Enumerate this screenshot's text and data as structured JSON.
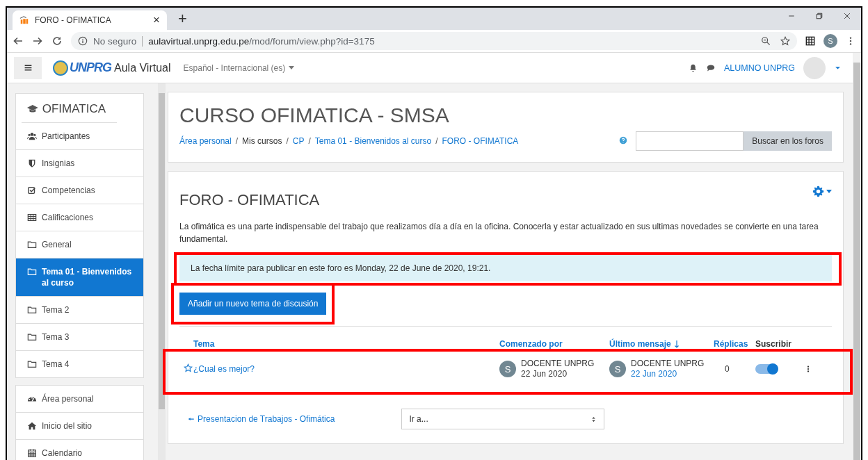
{
  "browser": {
    "tab_title": "FORO - OFIMATICA",
    "tab_close": "×",
    "new_tab": "+",
    "security": "No seguro",
    "url_host": "aulavirtual.unprg.edu.pe",
    "url_path": "/mod/forum/view.php?id=3175",
    "profile_initial": "S"
  },
  "navbar": {
    "logo": "UNPRG",
    "site_name": "Aula Virtual",
    "language": "Español - Internacional (es)",
    "user_name": "ALUMNO UNPRG"
  },
  "sidebar": {
    "course_title": "OFIMATICA",
    "items": [
      {
        "label": "Participantes",
        "kind": "users",
        "selected": false
      },
      {
        "label": "Insignias",
        "kind": "shield",
        "selected": false
      },
      {
        "label": "Competencias",
        "kind": "check",
        "selected": false
      },
      {
        "label": "Calificaciones",
        "kind": "table",
        "selected": false
      },
      {
        "label": "General",
        "kind": "folder",
        "selected": false
      },
      {
        "label": "Tema 01 - Bienvenidos al curso",
        "kind": "folder",
        "selected": true
      },
      {
        "label": "Tema 2",
        "kind": "folder",
        "selected": false
      },
      {
        "label": "Tema 3",
        "kind": "folder",
        "selected": false
      },
      {
        "label": "Tema 4",
        "kind": "folder",
        "selected": false
      }
    ],
    "site_items": [
      {
        "label": "Área personal",
        "kind": "gauge",
        "selected": false
      },
      {
        "label": "Inicio del sitio",
        "kind": "home",
        "selected": false
      },
      {
        "label": "Calendario",
        "kind": "calendar",
        "selected": false
      }
    ]
  },
  "header": {
    "course_name": "CURSO OFIMATICA - SMSA",
    "separators": [
      "/",
      "/",
      "/",
      "/"
    ],
    "breadcrumb": [
      {
        "label": "Área personal",
        "link": true
      },
      {
        "label": "Mis cursos",
        "link": false
      },
      {
        "label": "CP",
        "link": true
      },
      {
        "label": "Tema 01 - Bienvenidos al curso",
        "link": true
      },
      {
        "label": "FORO - OFIMATICA",
        "link": true
      }
    ],
    "search_button": "Buscar en los foros"
  },
  "forum": {
    "title": "FORO - OFIMATICA",
    "description": "La ofimática es una parte indispensable del trabajo que realizamos día a día en la oficina. Conocerla y estar actualizado en sus ultimas novedades se convierte en una tarea fundamental.",
    "notice": {
      "text": "La fecha límite para publicar en este foro es Monday, 22 de June de 2020, 19:21.",
      "highlighted": true
    },
    "add_button": {
      "label": "Añadir un nuevo tema de discusión",
      "highlighted": true
    },
    "columns": [
      {
        "label": "Tema",
        "link": true,
        "sorted": false
      },
      {
        "label": "Comenzado por",
        "link": true,
        "sorted": false
      },
      {
        "label": "Último mensaje",
        "link": true,
        "sorted": true
      },
      {
        "label": "Réplicas",
        "link": true,
        "sorted": false
      },
      {
        "label": "Suscribir",
        "link": false,
        "sorted": false
      }
    ],
    "discussions": [
      {
        "title": "¿Cual es mejor?",
        "starred": false,
        "started_initial": "S",
        "started_by": "DOCENTE UNPRG",
        "started_date": "22 Jun 2020",
        "last_initial": "S",
        "last_by": "DOCENTE UNPRG",
        "last_date": "22 Jun 2020",
        "replies": "0",
        "subscribed": true,
        "highlighted": true
      }
    ],
    "prev_link": "Presentacion de Trabajos - Ofimática",
    "jump_select": "Ir a..."
  }
}
